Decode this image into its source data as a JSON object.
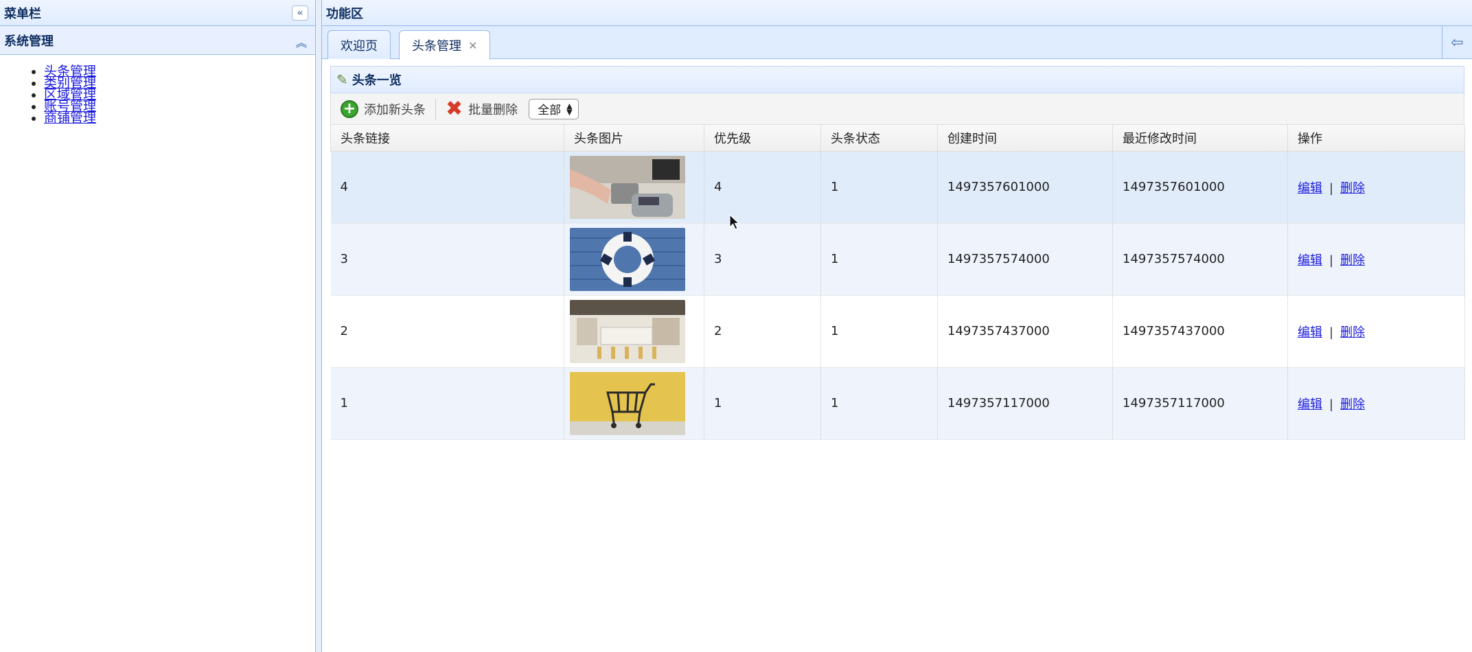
{
  "west": {
    "title": "菜单栏",
    "collapse_icon": "double-left-chevron",
    "accordion": {
      "title": "系统管理",
      "collapse_icon": "double-up-chevron",
      "items": [
        {
          "label": "头条管理"
        },
        {
          "label": "类别管理"
        },
        {
          "label": "区域管理"
        },
        {
          "label": "账号管理"
        },
        {
          "label": "商铺管理"
        }
      ]
    }
  },
  "center": {
    "title": "功能区",
    "tabs": [
      {
        "label": "欢迎页",
        "active": false
      },
      {
        "label": "头条管理",
        "active": true,
        "closable": true
      }
    ],
    "tabs_tool_icon": "back-arrow-icon",
    "grid": {
      "title": "头条一览",
      "toolbar": {
        "add_label": "添加新头条",
        "batch_delete_label": "批量删除",
        "filter_value": "全部"
      },
      "columns": [
        "头条链接",
        "头条图片",
        "优先级",
        "头条状态",
        "创建时间",
        "最近修改时间",
        "操作"
      ],
      "rows": [
        {
          "link": "4",
          "priority": "4",
          "status": "1",
          "create_time": "1497357601000",
          "edit_time": "1497357601000",
          "image": "payment-terminal-photo"
        },
        {
          "link": "3",
          "priority": "3",
          "status": "1",
          "create_time": "1497357574000",
          "edit_time": "1497357574000",
          "image": "life-ring-photo"
        },
        {
          "link": "2",
          "priority": "2",
          "status": "1",
          "create_time": "1497357437000",
          "edit_time": "1497357437000",
          "image": "store-interior-photo"
        },
        {
          "link": "1",
          "priority": "1",
          "status": "1",
          "create_time": "1497357117000",
          "edit_time": "1497357117000",
          "image": "shopping-cart-photo"
        }
      ],
      "actions": {
        "edit": "编辑",
        "separator": "|",
        "delete": "删除"
      }
    }
  }
}
